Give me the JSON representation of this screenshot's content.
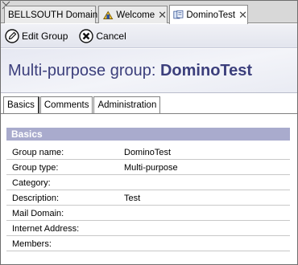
{
  "tabs": [
    {
      "label": "BELLSOUTH Domain",
      "icon": "none"
    },
    {
      "label": "Welcome",
      "icon": "welcome-icon"
    },
    {
      "label": "DominoTest",
      "icon": "directory-icon"
    }
  ],
  "toolbar": {
    "edit_label": "Edit Group",
    "cancel_label": "Cancel"
  },
  "header": {
    "prefix": "Multi-purpose group: ",
    "name": "DominoTest"
  },
  "doc_tabs": [
    "Basics",
    "Comments",
    "Administration"
  ],
  "section": {
    "title": "Basics",
    "fields": [
      {
        "label": "Group name:",
        "value": "DominoTest"
      },
      {
        "label": "Group type:",
        "value": "Multi-purpose"
      },
      {
        "label": "Category:",
        "value": ""
      },
      {
        "label": "Description:",
        "value": "Test"
      },
      {
        "label": "Mail Domain:",
        "value": ""
      },
      {
        "label": "Internet Address:",
        "value": ""
      },
      {
        "label": "Members:",
        "value": ""
      }
    ]
  },
  "colors": {
    "header_text": "#3c3f7c",
    "section_bar": "#a9abcd"
  }
}
